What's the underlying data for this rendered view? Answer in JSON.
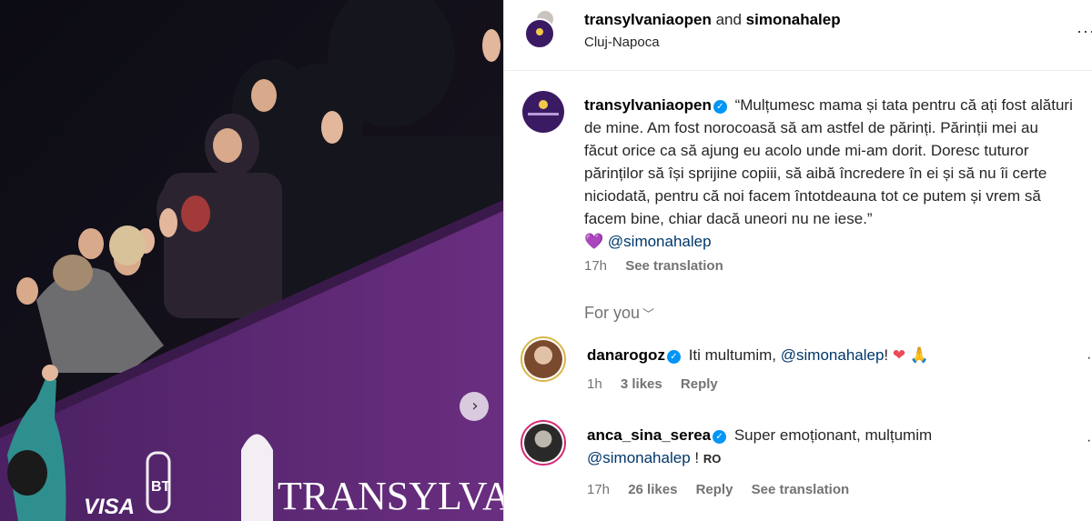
{
  "post": {
    "header": {
      "author1": "transylvaniaopen",
      "joiner": "and",
      "author2": "simonahalep",
      "location": "Cluj-Napoca",
      "more_icon": "more-horizontal-icon"
    },
    "photo": {
      "banner_text": "TRANSYLVANIA",
      "sponsor1": "VISA",
      "sponsor2": "BT",
      "next_icon": "chevron-right-icon"
    },
    "caption": {
      "username": "transylvaniaopen",
      "text": "“Mulțumesc mama și tata pentru că ați fost alături de mine. Am fost norocoasă să am astfel de părinți. Părinții mei au făcut orice ca să ajung eu acolo unde mi-am dorit. Doresc tuturor părinților să își sprijine copiii, să aibă încredere în ei și să nu îi certe niciodată, pentru că noi facem întotdeauna tot ce putem și vrem să facem bine, chiar dacă uneori nu ne iese.”",
      "emoji": "💜",
      "mention": "@simonahalep",
      "time": "17h",
      "see_translation": "See translation"
    },
    "for_you": "For you",
    "comments": [
      {
        "username": "danarogoz",
        "text": "Iti multumim,",
        "mention": "@simonahalep",
        "suffix": "!",
        "emoji1": "❤",
        "emoji2": "🙏",
        "time": "1h",
        "likes": "3 likes",
        "reply": "Reply"
      },
      {
        "username": "anca_sina_serea",
        "text": "Super emoționant, mulțumim",
        "mention": "@simonahalep",
        "suffix": "!",
        "flag": "RO",
        "time": "17h",
        "likes": "26 likes",
        "reply": "Reply",
        "see_translation": "See translation"
      }
    ]
  },
  "colors": {
    "verified": "#0095f6",
    "mention": "#00376b",
    "muted": "#737373",
    "banner_purple": "#5b2a6e"
  }
}
